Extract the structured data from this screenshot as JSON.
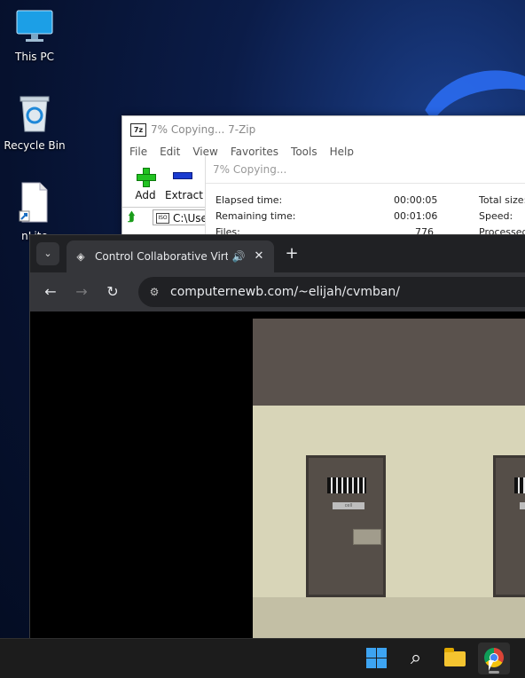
{
  "desktop": {
    "icons": [
      {
        "label": "This PC",
        "icon": "monitor-icon"
      },
      {
        "label": "Recycle Bin",
        "icon": "recycle-bin-icon"
      },
      {
        "label": "nLite",
        "icon": "file-shortcut-icon"
      }
    ]
  },
  "sevenzip": {
    "title": "7% Copying... 7-Zip",
    "logo_text": "7z",
    "menu": [
      "File",
      "Edit",
      "View",
      "Favorites",
      "Tools",
      "Help"
    ],
    "toolbar": {
      "add": "Add",
      "extract": "Extract"
    },
    "path": "C:\\Users",
    "drive_label": "ISO"
  },
  "copy_dialog": {
    "title": "7% Copying...",
    "elapsed_label": "Elapsed time:",
    "elapsed_value": "00:00:05",
    "remaining_label": "Remaining time:",
    "remaining_value": "00:01:06",
    "files_label": "Files:",
    "files_value": "776",
    "total_size_label": "Total size:",
    "speed_label": "Speed:",
    "processed_label": "Processed:"
  },
  "chrome": {
    "tab_title": "Control Collaborative Virtual",
    "url": "computernewb.com/~elijah/cvmban/"
  },
  "game": {
    "door_plate": "cell"
  },
  "colors": {
    "taskbar": "#1c1c1c",
    "chrome_frame": "#202124",
    "chrome_toolbar": "#35363a",
    "windows_blue": "#3da4f2"
  }
}
